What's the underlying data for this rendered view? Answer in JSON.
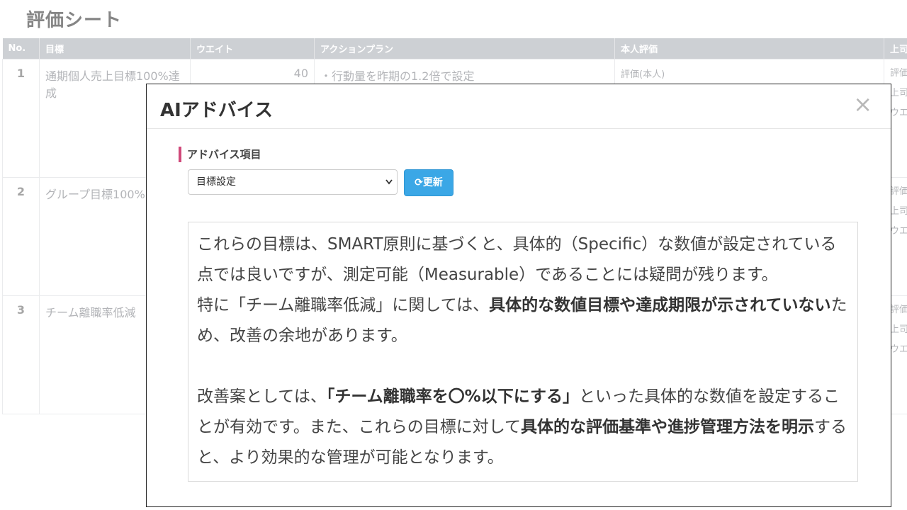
{
  "page_title": "評価シート",
  "table": {
    "headers": [
      "No.",
      "目標",
      "ウエイト",
      "アクションプラン",
      "本人評価",
      "上司"
    ],
    "rows": [
      {
        "no": "1",
        "goal": "通期個人売上目標100%達成",
        "weight": "40",
        "action": "・行動量を昨期の1.2倍で設定",
        "self": "評価(本人)",
        "boss1": "評価",
        "boss2": "上司",
        "boss3": "ウエ"
      },
      {
        "no": "2",
        "goal": "グループ目標100%",
        "weight": "",
        "action": "",
        "self": "",
        "boss1": "評価",
        "boss2": "上司",
        "boss3": "ウエ"
      },
      {
        "no": "3",
        "goal": "チーム離職率低減",
        "weight": "",
        "action": "",
        "self": "",
        "boss1": "評価",
        "boss2": "上司",
        "boss3": "ウエ"
      }
    ]
  },
  "modal": {
    "title": "AIアドバイス",
    "close_icon": "×",
    "section_label": "アドバイス項目",
    "select_value": "目標設定",
    "refresh_icon": "⟳",
    "refresh_label": "更新",
    "advice": {
      "p1": "これらの目標は、SMART原則に基づくと、具体的（Specific）な数値が設定されている点では良いですが、測定可能（Measurable）であることには疑問が残ります。",
      "p2_a": "特に「チーム離職率低減」に関しては、",
      "p2_b": "具体的な数値目標や達成期限が示されていない",
      "p2_c": "ため、改善の余地があります。",
      "p3_a": "改善案としては、",
      "p3_b": "「チーム離職率を〇%以下にする」",
      "p3_c": "といった具体的な数値を設定することが有効です。また、これらの目標に対して",
      "p3_d": "具体的な評価基準や進捗管理方法を明示",
      "p3_e": "すると、より効果的な管理が可能となります。"
    }
  },
  "colors": {
    "header_bg": "#b3b7bd",
    "accent_bar": "#d0497a",
    "button_blue": "#3ba7e6"
  }
}
